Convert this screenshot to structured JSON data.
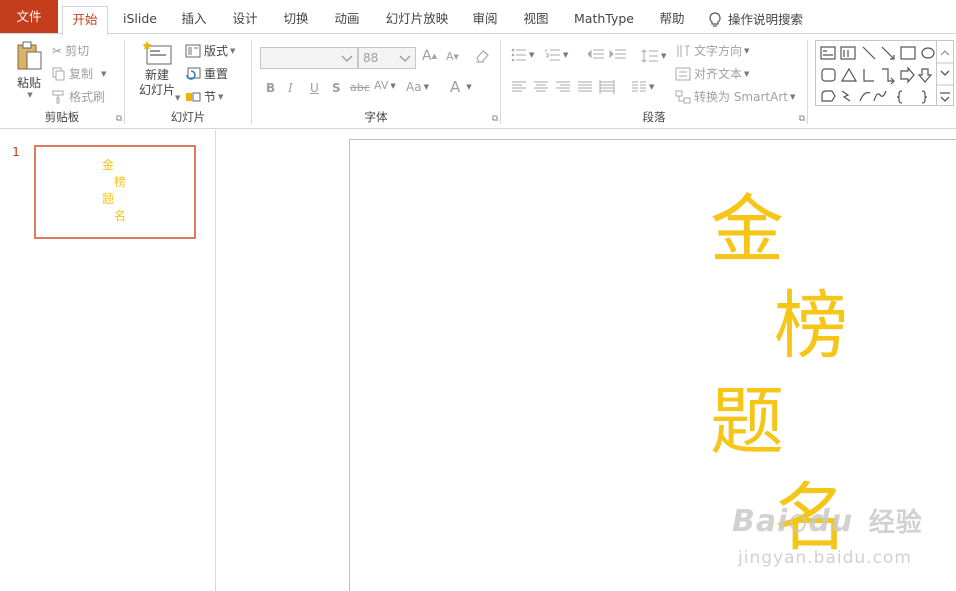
{
  "tabs": [
    "文件",
    "开始",
    "iSlide",
    "插入",
    "设计",
    "切换",
    "动画",
    "幻灯片放映",
    "审阅",
    "视图",
    "MathType",
    "帮助"
  ],
  "tell_me": "操作说明搜索",
  "clipboard": {
    "paste": "粘贴",
    "cut": "剪切",
    "copy": "复制",
    "format_painter": "格式刷",
    "label": "剪贴板"
  },
  "slides_group": {
    "new_slide_line1": "新建",
    "new_slide_line2": "幻灯片",
    "layout": "版式",
    "reset": "重置",
    "section": "节",
    "label": "幻灯片"
  },
  "font": {
    "font_name": "",
    "font_size": "88",
    "label": "字体",
    "bold": "B",
    "italic": "I",
    "underline": "U",
    "strike": "S",
    "shadow": "abc",
    "spacing": "AV",
    "case": "Aa",
    "color_a": "A"
  },
  "paragraph": {
    "text_direction": "文字方向",
    "align_text": "对齐文本",
    "smartart": "转换为 SmartArt",
    "label": "段落"
  },
  "slide_panel": {
    "number": "1",
    "chars": [
      "金",
      "榜",
      "题",
      "名"
    ]
  },
  "slide": {
    "chars": [
      "金",
      "榜",
      "题",
      "名"
    ]
  },
  "watermark": {
    "brand": "Bai",
    "brand_du": "du",
    "jingyan": "经验",
    "url": "jingyan.baidu.com"
  },
  "colors": {
    "accent": "#c43e1c",
    "text_gold": "#f5c518",
    "thumb_border": "#e07a5f"
  }
}
